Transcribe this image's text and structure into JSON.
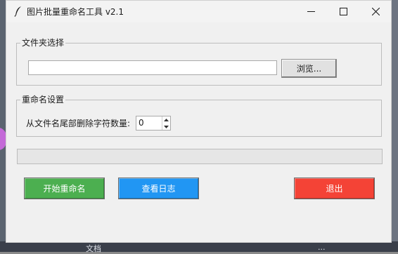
{
  "desktop": {
    "bottom_fragment_left": "文档",
    "bottom_fragment_right": "..."
  },
  "window": {
    "title": "图片批量重命名工具 v2.1",
    "icon": "feather-icon"
  },
  "folder_group": {
    "label": "文件夹选择",
    "path_value": "",
    "browse_label": "浏览..."
  },
  "rename_group": {
    "label": "重命名设置",
    "trim_label": "从文件名尾部删除字符数量:",
    "trim_value": "0"
  },
  "progress": {
    "value_percent": 0
  },
  "buttons": {
    "start": {
      "label": "开始重命名",
      "color": "#4caf50"
    },
    "log": {
      "label": "查看日志",
      "color": "#2196f3"
    },
    "exit": {
      "label": "退出",
      "color": "#f44336"
    }
  }
}
